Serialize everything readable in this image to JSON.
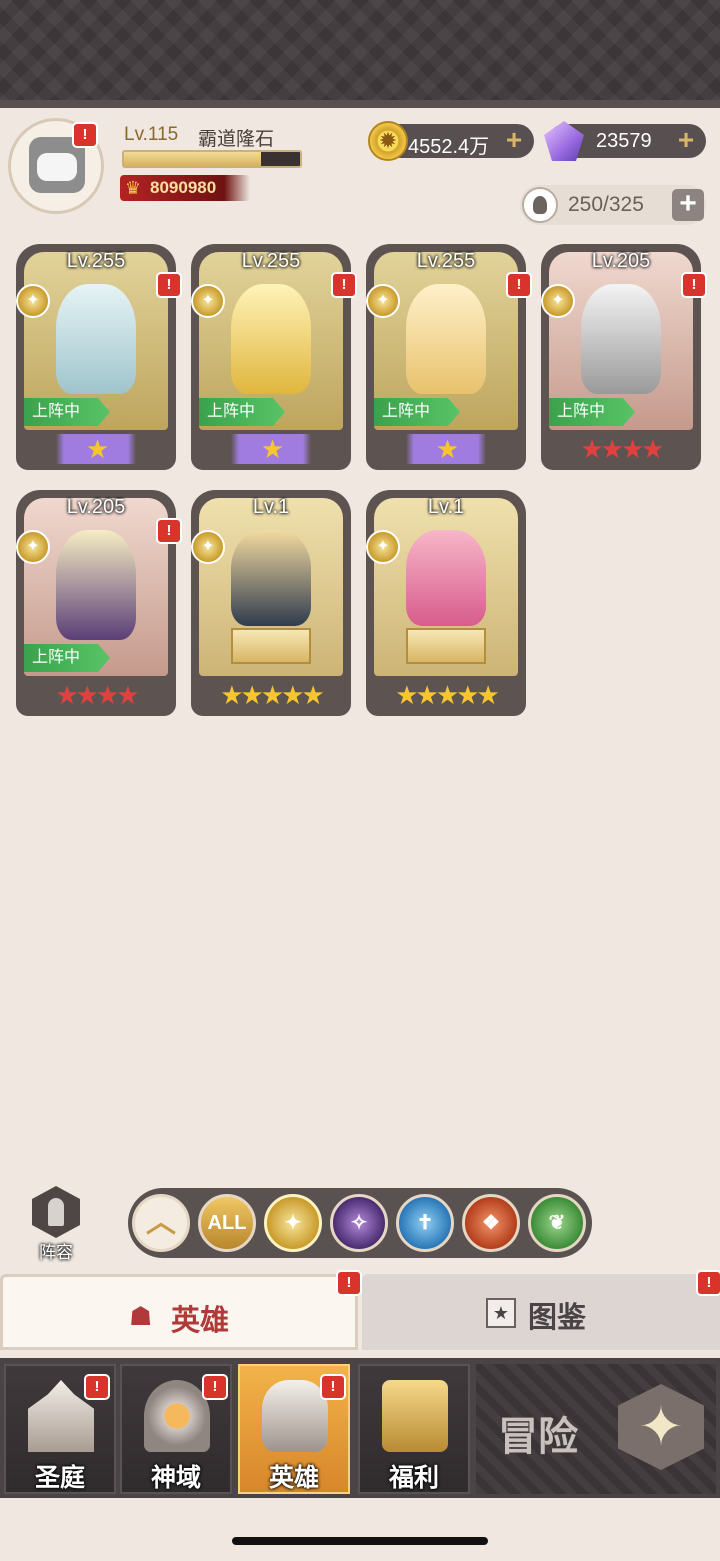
{
  "player": {
    "level": "Lv.115",
    "name": "霸道隆石",
    "xp_fraction": 0.78,
    "power": "8090980"
  },
  "resources": {
    "gold": "4552.4万",
    "gems": "23579",
    "hero_capacity": "250/325"
  },
  "heroes": [
    {
      "level": "Lv.255",
      "deployed_label": "上阵中",
      "stars": "★",
      "star_style": "purple"
    },
    {
      "level": "Lv.255",
      "deployed_label": "上阵中",
      "stars": "★",
      "star_style": "purple"
    },
    {
      "level": "Lv.255",
      "deployed_label": "上阵中",
      "stars": "★",
      "star_style": "purple"
    },
    {
      "level": "Lv.205",
      "deployed_label": "上阵中",
      "stars": "★★★★",
      "star_style": "red"
    },
    {
      "level": "Lv.205",
      "deployed_label": "上阵中",
      "stars": "★★★★",
      "star_style": "red"
    },
    {
      "level": "Lv.1",
      "deployed_label": "",
      "stars": "★★★★★",
      "star_style": "gold"
    },
    {
      "level": "Lv.1",
      "deployed_label": "",
      "stars": "★★★★★",
      "star_style": "gold"
    }
  ],
  "filters": {
    "formation_label": "阵容",
    "all_label": "ALL"
  },
  "tabs": {
    "heroes": "英雄",
    "codex": "图鉴"
  },
  "nav": {
    "sanctuary": "圣庭",
    "divine": "神域",
    "heroes": "英雄",
    "benefits": "福利",
    "adventure": "冒险"
  },
  "alert_mark": "!",
  "colors": {
    "accent_gold": "#d8862a",
    "alert_red": "#d9342b",
    "deployed_green": "#3aa24c"
  }
}
